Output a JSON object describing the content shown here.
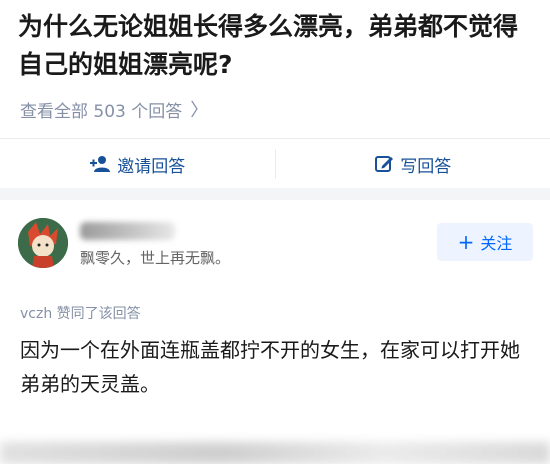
{
  "question": {
    "title": "为什么无论姐姐长得多么漂亮，弟弟都不觉得自己的姐姐漂亮呢?",
    "view_all": "查看全部 503 个回答",
    "view_all_chevron": "〉"
  },
  "actions": {
    "invite_label": "邀请回答",
    "write_label": "写回答"
  },
  "answer": {
    "author_bio": "飘零久，世上再无飘。",
    "follow_label": "关注",
    "follow_plus": "+",
    "voted_by": "vczh 赞同了该回答",
    "content": "因为一个在外面连瓶盖都拧不开的女生，在家可以打开她弟弟的天灵盖。"
  },
  "colors": {
    "link_blue": "#175199",
    "follow_blue": "#0066ff",
    "meta_gray": "#8590a6"
  },
  "icons": {
    "invite": "add-user-icon",
    "write": "edit-icon",
    "chevron": "chevron-right-icon"
  }
}
